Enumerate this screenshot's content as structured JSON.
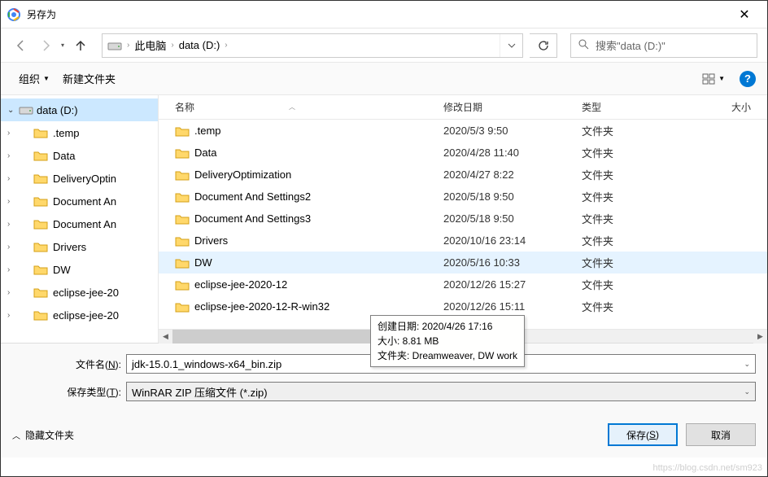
{
  "title": "另存为",
  "breadcrumbs": {
    "root": "此电脑",
    "drive": "data (D:)"
  },
  "search_placeholder": "搜索\"data (D:)\"",
  "toolbar": {
    "organize": "组织",
    "new_folder": "新建文件夹"
  },
  "columns": {
    "name": "名称",
    "date": "修改日期",
    "type": "类型",
    "size": "大小"
  },
  "tree": {
    "root": "data (D:)",
    "items": [
      ".temp",
      "Data",
      "DeliveryOptin",
      "Document An",
      "Document An",
      "Drivers",
      "DW",
      "eclipse-jee-20",
      "eclipse-jee-20"
    ]
  },
  "files": [
    {
      "name": ".temp",
      "date": "2020/5/3 9:50",
      "type": "文件夹",
      "hl": false
    },
    {
      "name": "Data",
      "date": "2020/4/28 11:40",
      "type": "文件夹",
      "hl": false
    },
    {
      "name": "DeliveryOptimization",
      "date": "2020/4/27 8:22",
      "type": "文件夹",
      "hl": false
    },
    {
      "name": "Document And Settings2",
      "date": "2020/5/18 9:50",
      "type": "文件夹",
      "hl": false
    },
    {
      "name": "Document And Settings3",
      "date": "2020/5/18 9:50",
      "type": "文件夹",
      "hl": false
    },
    {
      "name": "Drivers",
      "date": "2020/10/16 23:14",
      "type": "文件夹",
      "hl": false
    },
    {
      "name": "DW",
      "date": "2020/5/16 10:33",
      "type": "文件夹",
      "hl": true
    },
    {
      "name": "eclipse-jee-2020-12",
      "date": "2020/12/26 15:27",
      "type": "文件夹",
      "hl": false
    },
    {
      "name": "eclipse-jee-2020-12-R-win32",
      "date": "2020/12/26 15:11",
      "type": "文件夹",
      "hl": false
    }
  ],
  "tooltip": {
    "line1": "创建日期: 2020/4/26 17:16",
    "line2": "大小: 8.81 MB",
    "line3": "文件夹: Dreamweaver, DW  work"
  },
  "form": {
    "filename_label": "文件名(N):",
    "filename_value": "jdk-15.0.1_windows-x64_bin.zip",
    "type_label": "保存类型(T):",
    "type_value": "WinRAR ZIP 压缩文件 (*.zip)"
  },
  "footer": {
    "hide_folders": "隐藏文件夹",
    "save": "保存(S)",
    "cancel": "取消"
  },
  "watermark": "https://blog.csdn.net/sm923"
}
